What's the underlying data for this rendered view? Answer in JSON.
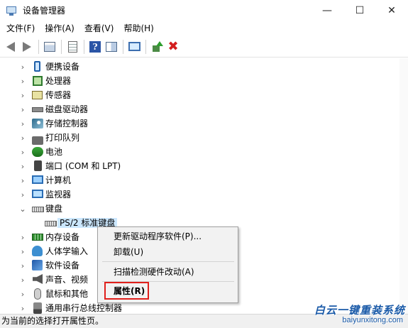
{
  "window": {
    "title": "设备管理器",
    "min_glyph": "—",
    "max_glyph": "☐",
    "close_glyph": "✕"
  },
  "menu": [
    {
      "label": "文件(F)"
    },
    {
      "label": "操作(A)"
    },
    {
      "label": "查看(V)"
    },
    {
      "label": "帮助(H)"
    }
  ],
  "toolbar": {
    "help_glyph": "?",
    "remove_glyph": "✖"
  },
  "tree": {
    "items": [
      {
        "label": "便携设备",
        "icon": "portable-device-icon"
      },
      {
        "label": "处理器",
        "icon": "processor-icon"
      },
      {
        "label": "传感器",
        "icon": "sensor-icon"
      },
      {
        "label": "磁盘驱动器",
        "icon": "disk-drive-icon"
      },
      {
        "label": "存储控制器",
        "icon": "storage-controller-icon"
      },
      {
        "label": "打印队列",
        "icon": "printer-icon"
      },
      {
        "label": "电池",
        "icon": "battery-icon"
      },
      {
        "label": "端口 (COM 和 LPT)",
        "icon": "port-icon"
      },
      {
        "label": "计算机",
        "icon": "computer-icon"
      },
      {
        "label": "监视器",
        "icon": "monitor-icon"
      },
      {
        "label": "键盘",
        "icon": "keyboard-icon",
        "expanded": true
      },
      {
        "label": "PS/2 标准键盘",
        "icon": "keyboard-icon",
        "child": true,
        "selected": true
      },
      {
        "label": "内存设备",
        "icon": "memory-icon"
      },
      {
        "label": "人体学输入",
        "icon": "human-interface-icon"
      },
      {
        "label": "软件设备",
        "icon": "software-device-icon"
      },
      {
        "label": "声音、视频",
        "icon": "audio-icon"
      },
      {
        "label": "鼠标和其他",
        "icon": "mouse-icon"
      },
      {
        "label": "通用串行总线控制器",
        "icon": "usb-icon"
      }
    ],
    "collapsed_glyph": "›",
    "expanded_glyph": "⌄"
  },
  "context_menu": {
    "items": [
      {
        "label": "更新驱动程序软件(P)..."
      },
      {
        "label": "卸载(U)"
      },
      {
        "label": "扫描检测硬件改动(A)"
      },
      {
        "label": "属性(R)"
      }
    ],
    "highlight_color": "#e0201c"
  },
  "status": {
    "text": "为当前的选择打开属性页。"
  },
  "watermark": {
    "cn": "白云一键重装系统",
    "en": "baiyunxitong.com"
  }
}
